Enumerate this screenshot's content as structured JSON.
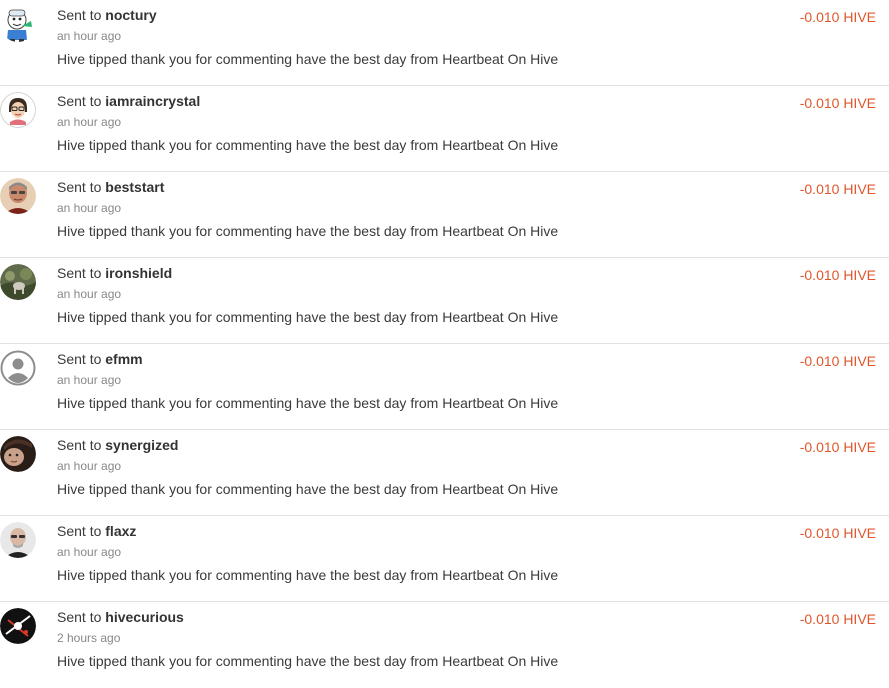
{
  "colors": {
    "amount": "#e0562b",
    "divider": "#e2e2e2",
    "secondary_text": "#888888",
    "primary_text": "#333333"
  },
  "transfers": [
    {
      "prefix": "Sent to",
      "user": "noctury",
      "time": "an hour ago",
      "memo": "Hive tipped thank you for commenting have the best day from Heartbeat On Hive",
      "amount": "-0.010 HIVE",
      "avatar": "cartoon-character-avatar-icon"
    },
    {
      "prefix": "Sent to",
      "user": "iamraincrystal",
      "time": "an hour ago",
      "memo": "Hive tipped thank you for commenting have the best day from Heartbeat On Hive",
      "amount": "-0.010 HIVE",
      "avatar": "cartoon-girl-avatar-icon"
    },
    {
      "prefix": "Sent to",
      "user": "beststart",
      "time": "an hour ago",
      "memo": "Hive tipped thank you for commenting have the best day from Heartbeat On Hive",
      "amount": "-0.010 HIVE",
      "avatar": "portrait-photo-avatar-icon"
    },
    {
      "prefix": "Sent to",
      "user": "ironshield",
      "time": "an hour ago",
      "memo": "Hive tipped thank you for commenting have the best day from Heartbeat On Hive",
      "amount": "-0.010 HIVE",
      "avatar": "outdoor-photo-avatar-icon"
    },
    {
      "prefix": "Sent to",
      "user": "efmm",
      "time": "an hour ago",
      "memo": "Hive tipped thank you for commenting have the best day from Heartbeat On Hive",
      "amount": "-0.010 HIVE",
      "avatar": "default-user-avatar-icon"
    },
    {
      "prefix": "Sent to",
      "user": "synergized",
      "time": "an hour ago",
      "memo": "Hive tipped thank you for commenting have the best day from Heartbeat On Hive",
      "amount": "-0.010 HIVE",
      "avatar": "face-photo-avatar-icon"
    },
    {
      "prefix": "Sent to",
      "user": "flaxz",
      "time": "an hour ago",
      "memo": "Hive tipped thank you for commenting have the best day from Heartbeat On Hive",
      "amount": "-0.010 HIVE",
      "avatar": "bald-man-avatar-icon"
    },
    {
      "prefix": "Sent to",
      "user": "hivecurious",
      "time": "2 hours ago",
      "memo": "Hive tipped thank you for commenting have the best day from Heartbeat On Hive",
      "amount": "-0.010 HIVE",
      "avatar": "dark-graphic-avatar-icon"
    }
  ]
}
